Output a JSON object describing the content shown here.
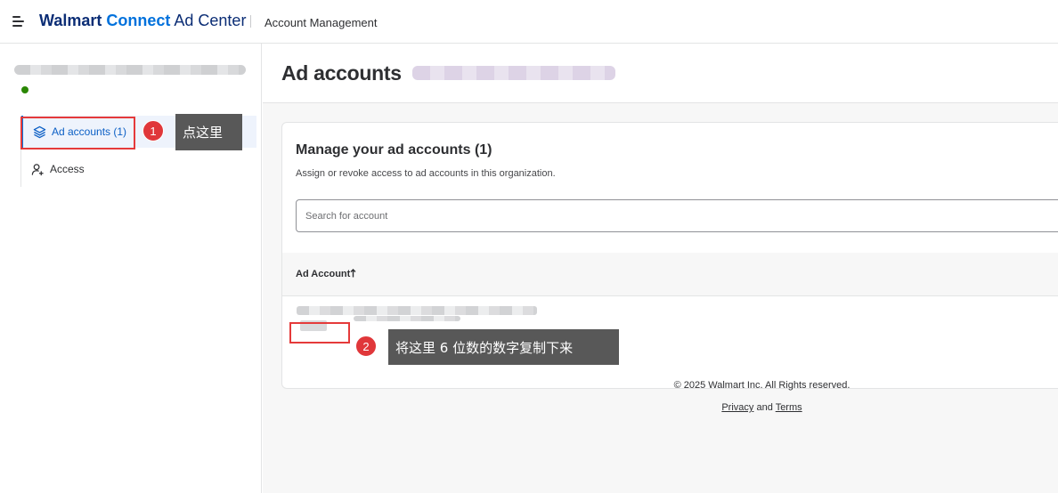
{
  "topbar": {
    "brand_walmart": "Walmart",
    "brand_connect": "Connect",
    "brand_adcenter": "Ad Center",
    "section": "Account Management"
  },
  "sidebar": {
    "items": [
      {
        "label": "Ad accounts (1)",
        "icon": "layers-icon",
        "active": true
      },
      {
        "label": "Access",
        "icon": "user-plus-icon",
        "active": false
      }
    ]
  },
  "main": {
    "page_title": "Ad accounts",
    "card": {
      "title": "Manage your ad accounts (1)",
      "subtitle": "Assign or revoke access to ad accounts in this organization.",
      "search_placeholder": "Search for account",
      "column_header": "Ad Account",
      "sort_icon": "arrow-up-icon"
    },
    "footer": {
      "copyright": "© 2025 Walmart Inc. All Rights reserved.",
      "privacy": "Privacy",
      "and": "and",
      "terms": "Terms"
    }
  },
  "annotations": {
    "step1_number": "1",
    "step1_text": "点这里",
    "step2_number": "2",
    "step2_text": "将这里 6 位数的数字复制下来"
  },
  "colors": {
    "brand_navy": "#0b2d75",
    "brand_blue": "#0071dc",
    "highlight_red": "#e53a3a",
    "status_green": "#2a8703",
    "callout_gray": "#585858"
  }
}
